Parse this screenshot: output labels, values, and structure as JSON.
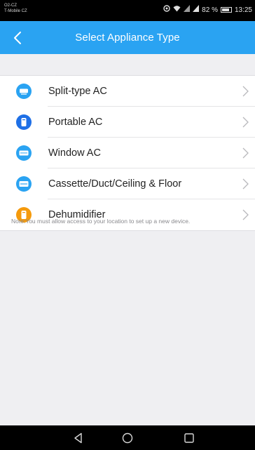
{
  "status_bar": {
    "carrier_line1": "O2-CZ",
    "carrier_line2": "T-Mobile CZ",
    "battery_percent": "82 %",
    "time": "13:25",
    "icons": [
      "data-icon",
      "wifi-icon",
      "signal-icon",
      "signal-icon",
      "battery-icon"
    ]
  },
  "app_bar": {
    "title": "Select Appliance Type",
    "back_icon": "chevron-left-icon",
    "color": "#2aa3f2"
  },
  "appliances": [
    {
      "label": "Split-type AC",
      "icon": "split-ac-icon",
      "color": "#2aa3f2"
    },
    {
      "label": "Portable AC",
      "icon": "portable-ac-icon",
      "color": "#1e6fe6"
    },
    {
      "label": "Window AC",
      "icon": "window-ac-icon",
      "color": "#2aa3f2"
    },
    {
      "label": "Cassette/Duct/Ceiling & Floor",
      "icon": "cassette-ac-icon",
      "color": "#2aa3f2"
    },
    {
      "label": "Dehumidifier",
      "icon": "dehumidifier-icon",
      "color": "#f59a0c"
    }
  ],
  "note": "Note:You must allow access to your location to set up a new device.",
  "nav_bar": {
    "icons": [
      "back-triangle-icon",
      "home-circle-icon",
      "recents-square-icon"
    ]
  }
}
